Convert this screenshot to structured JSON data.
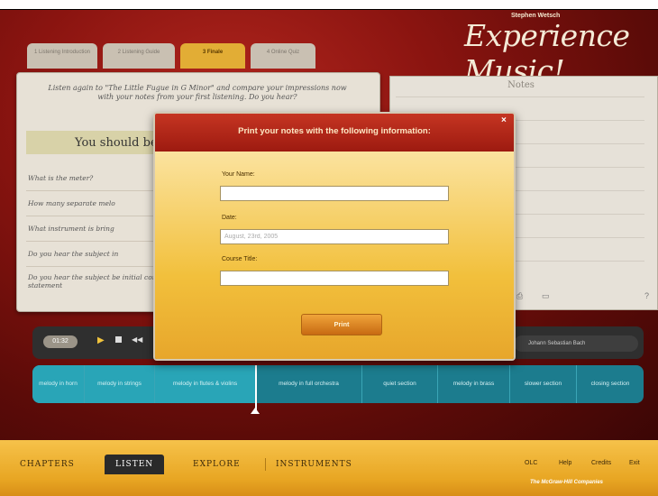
{
  "brand": {
    "small": "Stephen Wetsch",
    "title": "Experience Music!"
  },
  "tabs": [
    "1 Listening Introduction",
    "2 Listening Guide",
    "3 Finale",
    "4 Online Quiz"
  ],
  "left_panel": {
    "intro": "Listen again to \"The Little Fugue in G Minor\" and compare your impressions now with your notes from your first listening. Do you hear?",
    "heading": "You should be a",
    "questions": [
      "What is the meter?",
      "How many separate melo",
      "What instrument is bring",
      "Do you hear the subject in",
      "Do you hear the subject be initial complete statement"
    ]
  },
  "notes": {
    "title": "Notes"
  },
  "player": {
    "time": "01:32",
    "right_label": "Johann Sebastian Bach"
  },
  "segments": [
    "melody in horn",
    "melody in strings",
    "melody in flutes & violins",
    "melody in full orchestra",
    "quiet section",
    "melody in brass",
    "slower section",
    "closing section"
  ],
  "modal": {
    "title": "Print your notes with the following information:",
    "name_label": "Your Name:",
    "name_value": "",
    "date_label": "Date:",
    "date_value": "August, 23rd, 2005",
    "course_label": "Course Title:",
    "course_value": "",
    "print_label": "Print"
  },
  "bottom_nav": [
    "CHAPTERS",
    "LISTEN",
    "EXPLORE",
    "INSTRUMENTS"
  ],
  "bottom_links": [
    "OLC",
    "Help",
    "Credits",
    "Exit"
  ],
  "publisher": "The McGraw-Hill Companies"
}
